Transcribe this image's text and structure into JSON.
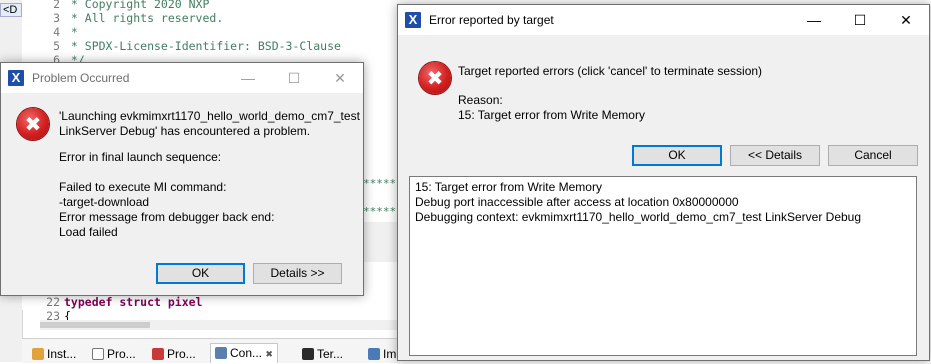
{
  "ide": {
    "left_tab_fragment": "<D",
    "code_lines": [
      {
        "num": "2",
        "text": " * Copyright 2020 NXP"
      },
      {
        "num": "3",
        "text": " * All rights reserved."
      },
      {
        "num": "4",
        "text": " *"
      },
      {
        "num": "5",
        "text": " * SPDX-License-Identifier: BSD-3-Clause"
      },
      {
        "num": "6",
        "text": " */"
      },
      {
        "num": "22",
        "text": "typedef struct pixel"
      },
      {
        "num": "23",
        "text": "{"
      }
    ],
    "stars": [
      "*****",
      "*****"
    ],
    "bottom_tabs": [
      {
        "label": "Inst..."
      },
      {
        "label": "Pro..."
      },
      {
        "label": "Pro..."
      },
      {
        "label": "Con...",
        "close": "✖"
      },
      {
        "label": "Ter..."
      },
      {
        "label": "Im"
      }
    ]
  },
  "problem_dialog": {
    "title": "Problem Occurred",
    "message_lines": [
      "'Launching evkmimxrt1170_hello_world_demo_cm7_test",
      "LinkServer Debug' has encountered a problem."
    ],
    "error_lines": [
      "Error in final launch sequence:",
      "",
      "Failed to execute MI command:",
      "-target-download",
      "Error message from debugger back end:",
      "Load failed"
    ],
    "ok_label": "OK",
    "details_label": "Details >>"
  },
  "error_dialog": {
    "title": "Error reported by target",
    "message": "Target reported errors (click 'cancel' to terminate session)",
    "reason_label": "Reason:",
    "reason_text": "15: Target error from Write Memory",
    "ok_label": "OK",
    "details_label": "<< Details",
    "cancel_label": "Cancel",
    "details_lines": [
      "15: Target error from Write Memory",
      "Debug port inaccessible after access at location 0x80000000",
      "Debugging context: evkmimxrt1170_hello_world_demo_cm7_test LinkServer Debug"
    ]
  },
  "window_controls": {
    "minimize": "—",
    "maximize": "☐",
    "close": "✕"
  },
  "icons": {
    "app": "X",
    "error": "✖"
  },
  "colors": {
    "accent": "#0078d7",
    "error_red": "#d21f1f",
    "comment_green": "#3f7f5f",
    "keyword": "#7f0055"
  }
}
